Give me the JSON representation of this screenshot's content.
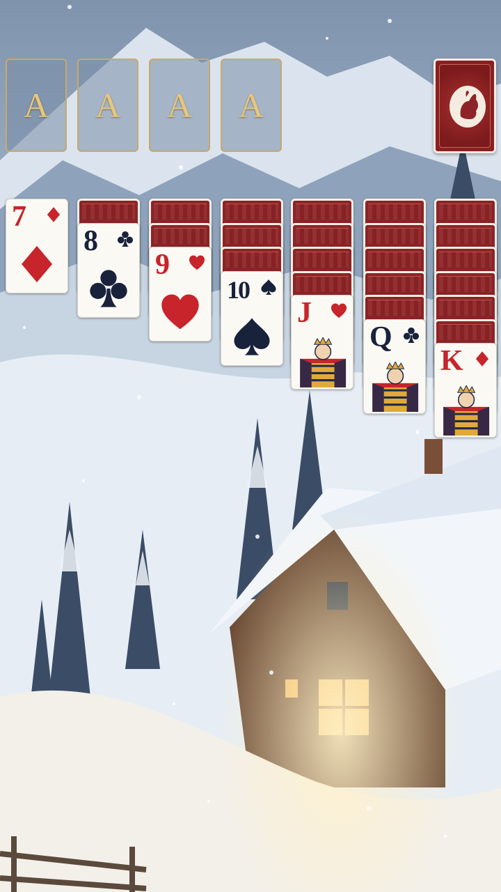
{
  "foundations": [
    {
      "label": "A"
    },
    {
      "label": "A"
    },
    {
      "label": "A"
    },
    {
      "label": "A"
    }
  ],
  "stock": {
    "icon": "rabbit-emblem-icon"
  },
  "tableau": [
    {
      "hidden_count": 0,
      "face": {
        "rank": "7",
        "suit": "diamond",
        "color": "red"
      }
    },
    {
      "hidden_count": 1,
      "face": {
        "rank": "8",
        "suit": "club",
        "color": "black"
      }
    },
    {
      "hidden_count": 2,
      "face": {
        "rank": "9",
        "suit": "heart",
        "color": "red"
      }
    },
    {
      "hidden_count": 3,
      "face": {
        "rank": "10",
        "suit": "spade",
        "color": "black"
      }
    },
    {
      "hidden_count": 4,
      "face": {
        "rank": "J",
        "suit": "heart",
        "color": "red"
      }
    },
    {
      "hidden_count": 5,
      "face": {
        "rank": "Q",
        "suit": "club",
        "color": "black"
      }
    },
    {
      "hidden_count": 6,
      "face": {
        "rank": "K",
        "suit": "diamond",
        "color": "red"
      }
    }
  ],
  "colors": {
    "card_back": "#8d2326",
    "card_face": "#fbf9f4",
    "red_suit": "#c8242b",
    "black_suit": "#18223b",
    "foundation_border": "#c9a86a",
    "foundation_letter": "#e7c77e"
  }
}
